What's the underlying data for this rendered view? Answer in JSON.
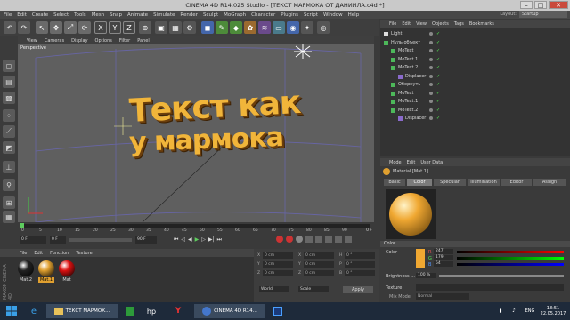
{
  "window": {
    "title": "CINEMA 4D R14.025 Studio - [ТЕКСТ МАРМОКА ОТ ДАНИИЛА.c4d *]"
  },
  "menubar": [
    "File",
    "Edit",
    "Create",
    "Select",
    "Tools",
    "Mesh",
    "Snap",
    "Animate",
    "Simulate",
    "Render",
    "Sculpt",
    "MoGraph",
    "Character",
    "Plugins",
    "Script",
    "Window",
    "Help"
  ],
  "layout": {
    "label": "Layout:",
    "value": "Startup"
  },
  "viewport": {
    "menu": [
      "View",
      "Cameras",
      "Display",
      "Options",
      "Filter",
      "Panel"
    ],
    "label": "Perspective",
    "text_line1": "Текст как",
    "text_line2": "у мармока"
  },
  "timeline": {
    "ticks": [
      "0",
      "5",
      "10",
      "15",
      "20",
      "25",
      "30",
      "35",
      "40",
      "45",
      "50",
      "55",
      "60",
      "65",
      "70",
      "75",
      "80",
      "85",
      "90"
    ],
    "end_label": "0 F",
    "start_field": "0 F",
    "end_field": "90 F",
    "start_field2": "0 F"
  },
  "materials": {
    "menu": [
      "File",
      "Edit",
      "Function",
      "Texture"
    ],
    "items": [
      {
        "name": "Mat.2",
        "color": "#222222"
      },
      {
        "name": "Mat.1",
        "color": "#e0a030"
      },
      {
        "name": "Mat",
        "color": "#dd1111"
      }
    ]
  },
  "coords": {
    "rows": [
      {
        "a": "X",
        "av": "0 cm",
        "b": "X",
        "bv": "0 cm",
        "c": "H",
        "cv": "0 °"
      },
      {
        "a": "Y",
        "av": "0 cm",
        "b": "Y",
        "bv": "0 cm",
        "c": "P",
        "cv": "0 °"
      },
      {
        "a": "Z",
        "av": "0 cm",
        "b": "Z",
        "bv": "0 cm",
        "c": "B",
        "cv": "0 °"
      }
    ],
    "world": "World",
    "scale": "Scale",
    "apply": "Apply"
  },
  "objmgr": {
    "menu": [
      "File",
      "Edit",
      "View",
      "Objects",
      "Tags",
      "Bookmarks"
    ],
    "rows": [
      {
        "name": "Light",
        "indent": 0
      },
      {
        "name": "Нуль объект",
        "indent": 0
      },
      {
        "name": "MoText",
        "indent": 1
      },
      {
        "name": "MoText.1",
        "indent": 1
      },
      {
        "name": "MoText.2",
        "indent": 1
      },
      {
        "name": "Displacer",
        "indent": 2
      },
      {
        "name": "Обернуть",
        "indent": 1
      },
      {
        "name": "MoText",
        "indent": 1
      },
      {
        "name": "MoText.1",
        "indent": 1
      },
      {
        "name": "MoText.2",
        "indent": 1
      },
      {
        "name": "Displacer",
        "indent": 2
      }
    ]
  },
  "attr": {
    "menu": [
      "Mode",
      "Edit",
      "User Data"
    ],
    "heading": "Material [Mat.1]",
    "tabs": [
      "Basic",
      "Color",
      "Specular",
      "Illumination",
      "Editor",
      "Assign"
    ],
    "section": "Color",
    "color_label": "Color",
    "r": "247",
    "g": "179",
    "b": "54",
    "brightness_label": "Brightness ...",
    "brightness": "100 %",
    "texture_label": "Texture",
    "mix_mode_label": "Mix Mode",
    "mix_mode": "Normal",
    "color_hex": "#f0a832"
  },
  "taskbar": {
    "app_label": "ТЕКСТ МАРМОК...",
    "c4d_label": "CINEMA 4D R14...",
    "lang": "ENG",
    "time": "18:51",
    "date": "22.05.2017"
  }
}
